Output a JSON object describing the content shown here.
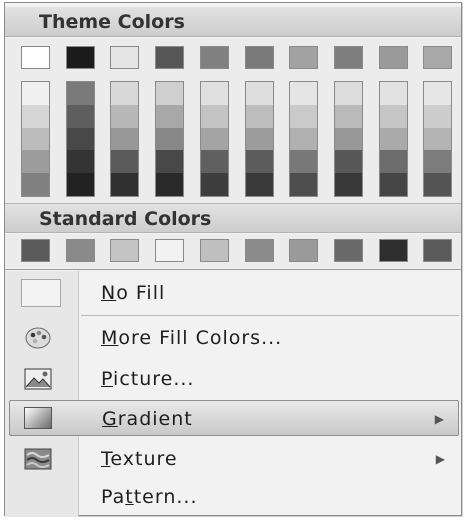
{
  "theme_section": {
    "title": "Theme Colors",
    "top_row": [
      "#ffffff",
      "#1c1c1c",
      "#e4e4e4",
      "#575757",
      "#808080",
      "#7a7a7a",
      "#a2a2a2",
      "#7e7e7e",
      "#9a9a9a",
      "#a8a8a8"
    ],
    "shade_columns": [
      [
        "#f0f0f0",
        "#d6d6d6",
        "#bcbcbc",
        "#9c9c9c",
        "#808080"
      ],
      [
        "#7a7a7a",
        "#5e5e5e",
        "#484848",
        "#343434",
        "#222222"
      ],
      [
        "#d8d8d8",
        "#b8b8b8",
        "#989898",
        "#5a5a5a",
        "#303030"
      ],
      [
        "#cfcfcf",
        "#a8a8a8",
        "#888888",
        "#484848",
        "#2a2a2a"
      ],
      [
        "#e0e0e0",
        "#c4c4c4",
        "#a4a4a4",
        "#606060",
        "#3e3e3e"
      ],
      [
        "#dedede",
        "#bdbdbd",
        "#9c9c9c",
        "#5c5c5c",
        "#3a3a3a"
      ],
      [
        "#e4e4e4",
        "#cacaca",
        "#b0b0b0",
        "#787878",
        "#4e4e4e"
      ],
      [
        "#dcdcdc",
        "#bababa",
        "#989898",
        "#585858",
        "#383838"
      ],
      [
        "#e2e2e2",
        "#c6c6c6",
        "#aaaaaa",
        "#6c6c6c",
        "#464646"
      ],
      [
        "#e6e6e6",
        "#cdcdcd",
        "#b4b4b4",
        "#7c7c7c",
        "#545454"
      ]
    ]
  },
  "standard_section": {
    "title": "Standard Colors",
    "swatches": [
      "#5a5a5a",
      "#8a8a8a",
      "#c4c4c4",
      "#f2f2f2",
      "#c0c0c0",
      "#8c8c8c",
      "#9a9a9a",
      "#6a6a6a",
      "#2e2e2e",
      "#5a5a5a"
    ]
  },
  "items": {
    "no_fill": {
      "pre": "",
      "u": "N",
      "post": "o Fill"
    },
    "more_colors": {
      "pre": "",
      "u": "M",
      "post": "ore Fill Colors..."
    },
    "picture": {
      "pre": "",
      "u": "P",
      "post": "icture..."
    },
    "gradient": {
      "pre": "",
      "u": "G",
      "post": "radient",
      "arrow": "▶"
    },
    "texture": {
      "pre": "",
      "u": "T",
      "post": "exture",
      "arrow": "▶"
    },
    "pattern": {
      "pre": "Pa",
      "u": "t",
      "post": "tern..."
    }
  }
}
